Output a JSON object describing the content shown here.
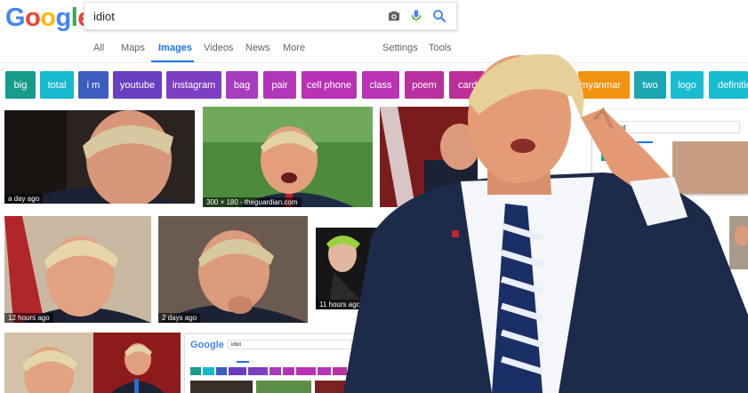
{
  "logo": {
    "text": "Google",
    "letters": [
      "G",
      "o",
      "o",
      "g",
      "l",
      "e"
    ],
    "colors": [
      "#4285F4",
      "#EA4335",
      "#FBBC05",
      "#4285F4",
      "#34A853",
      "#EA4335"
    ]
  },
  "search": {
    "query": "idiot",
    "icons": [
      "camera-icon",
      "microphone-icon",
      "search-icon"
    ]
  },
  "tabs": [
    {
      "label": "All"
    },
    {
      "label": "Maps"
    },
    {
      "label": "Images",
      "active": true
    },
    {
      "label": "Videos"
    },
    {
      "label": "News"
    },
    {
      "label": "More"
    }
  ],
  "tools": {
    "settings": "Settings",
    "tools": "Tools"
  },
  "chips": [
    {
      "label": "big",
      "color": "#179c8c"
    },
    {
      "label": "total",
      "color": "#17b9cc"
    },
    {
      "label": "i m",
      "color": "#3d5cbf"
    },
    {
      "label": "youtube",
      "color": "#6a3fbf"
    },
    {
      "label": "instagram",
      "color": "#7c3fc1"
    },
    {
      "label": "bag",
      "color": "#a73cbd"
    },
    {
      "label": "pair",
      "color": "#b237b8"
    },
    {
      "label": "cell phone",
      "color": "#b931b5"
    },
    {
      "label": "class",
      "color": "#b933b4"
    },
    {
      "label": "poem",
      "color": "#b8319f"
    },
    {
      "label": "card",
      "color": "#bc2f99"
    },
    {
      "label": "myanmar",
      "color": "#f2930f"
    },
    {
      "label": "two",
      "color": "#1aa6b2"
    },
    {
      "label": "logo",
      "color": "#17bcd0"
    },
    {
      "label": "definitio",
      "color": "#17bcd0"
    }
  ],
  "thumbnails": [
    {
      "caption": "a day ago"
    },
    {
      "caption": "300 × 180 - theguardian.com"
    },
    {
      "caption": "12 hours ago"
    },
    {
      "caption": "2 days ago"
    },
    {
      "caption": "11 hours ago"
    }
  ],
  "mini_screenshot": {
    "logo": "Google",
    "query": "idiot"
  },
  "inset_screenshot": {
    "query": "idiot"
  },
  "accent_color": "#1a73e8"
}
